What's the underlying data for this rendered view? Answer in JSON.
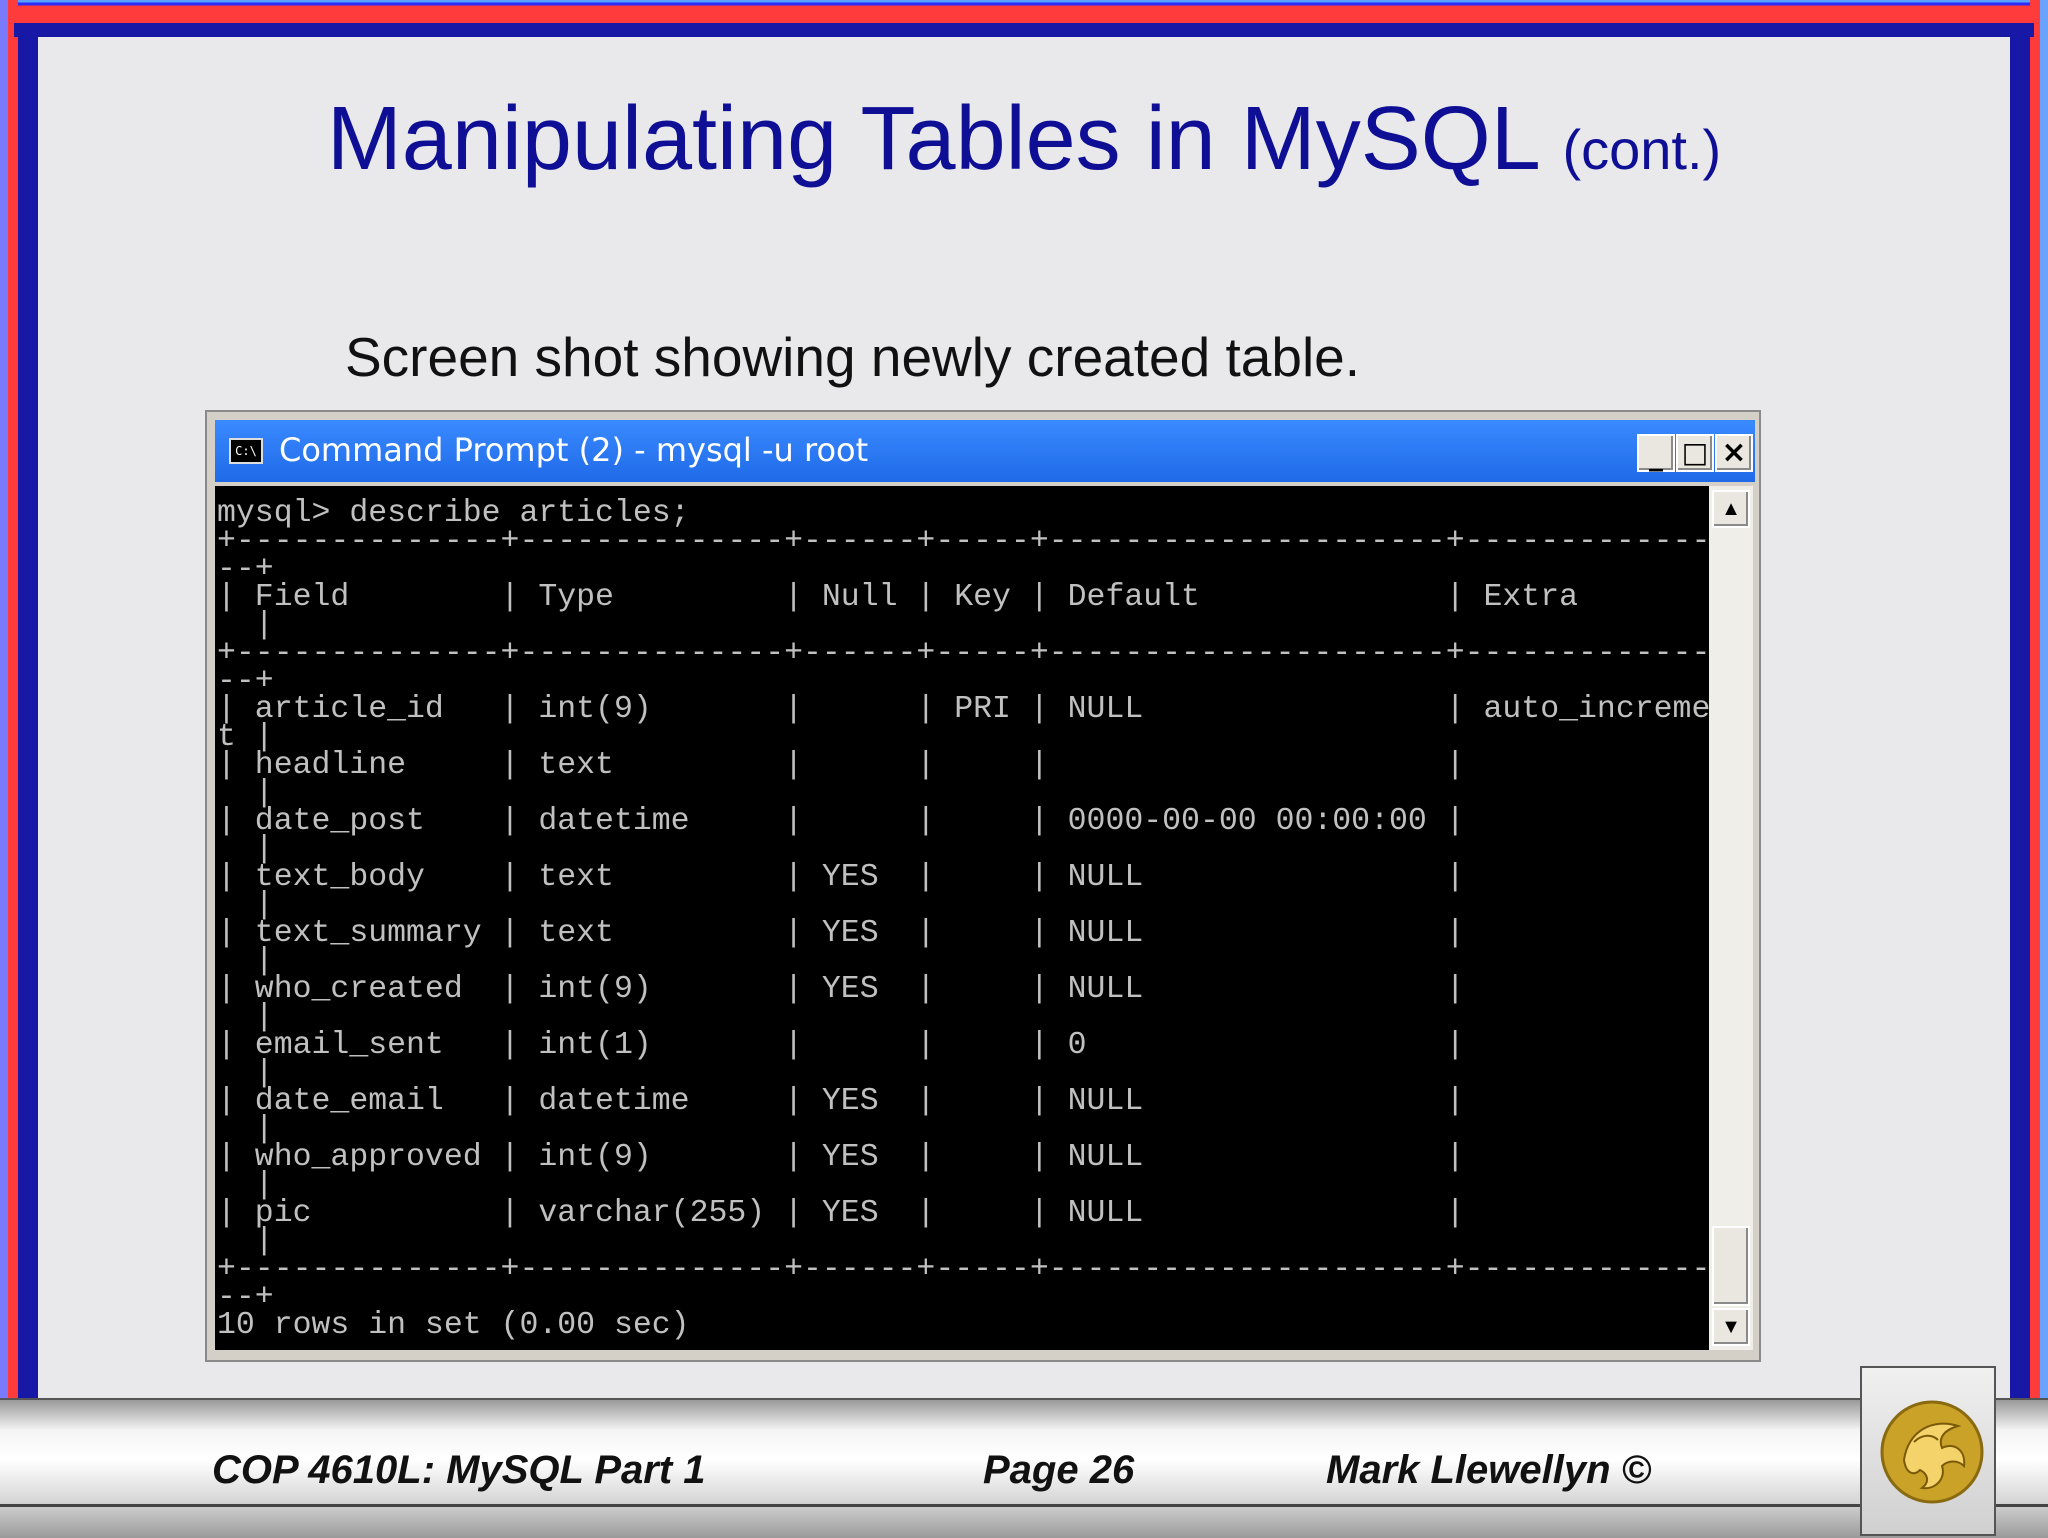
{
  "slide": {
    "title_main": "Manipulating Tables in MySQL",
    "title_suffix": "(cont.)",
    "subtitle": "Screen shot showing newly created table."
  },
  "window": {
    "icon_text": "C:\\",
    "title": "Command Prompt (2) - mysql -u root",
    "minimize_label": "_",
    "maximize_label": "□",
    "close_label": "×"
  },
  "console": {
    "text": "mysql> describe articles;\n+--------------+--------------+------+-----+---------------------+--------------\n--+\n| Field        | Type         | Null | Key | Default             | Extra\n  |\n+--------------+--------------+------+-----+---------------------+--------------\n--+\n| article_id   | int(9)       |      | PRI | NULL                | auto_incremen\nt |\n| headline     | text         |      |     |                     |\n  |\n| date_post    | datetime     |      |     | 0000-00-00 00:00:00 |\n  |\n| text_body    | text         | YES  |     | NULL                |\n  |\n| text_summary | text         | YES  |     | NULL                |\n  |\n| who_created  | int(9)       | YES  |     | NULL                |\n  |\n| email_sent   | int(1)       |      |     | 0                   |\n  |\n| date_email   | datetime     | YES  |     | NULL                |\n  |\n| who_approved | int(9)       | YES  |     | NULL                |\n  |\n| pic          | varchar(255) | YES  |     | NULL                |\n  |\n+--------------+--------------+------+-----+---------------------+--------------\n--+\n10 rows in set (0.00 sec)"
  },
  "scrollbar": {
    "up_arrow": "▲",
    "down_arrow": "▼"
  },
  "footer": {
    "course": "COP 4610L: MySQL Part 1",
    "page": "Page 26",
    "author": "Mark Llewellyn ©"
  },
  "colors": {
    "title": "#0f0f96",
    "titlebar": "#1f6ae8",
    "console_bg": "#000000",
    "console_text": "#c0c0c0",
    "logo_gold": "#c9a227"
  }
}
